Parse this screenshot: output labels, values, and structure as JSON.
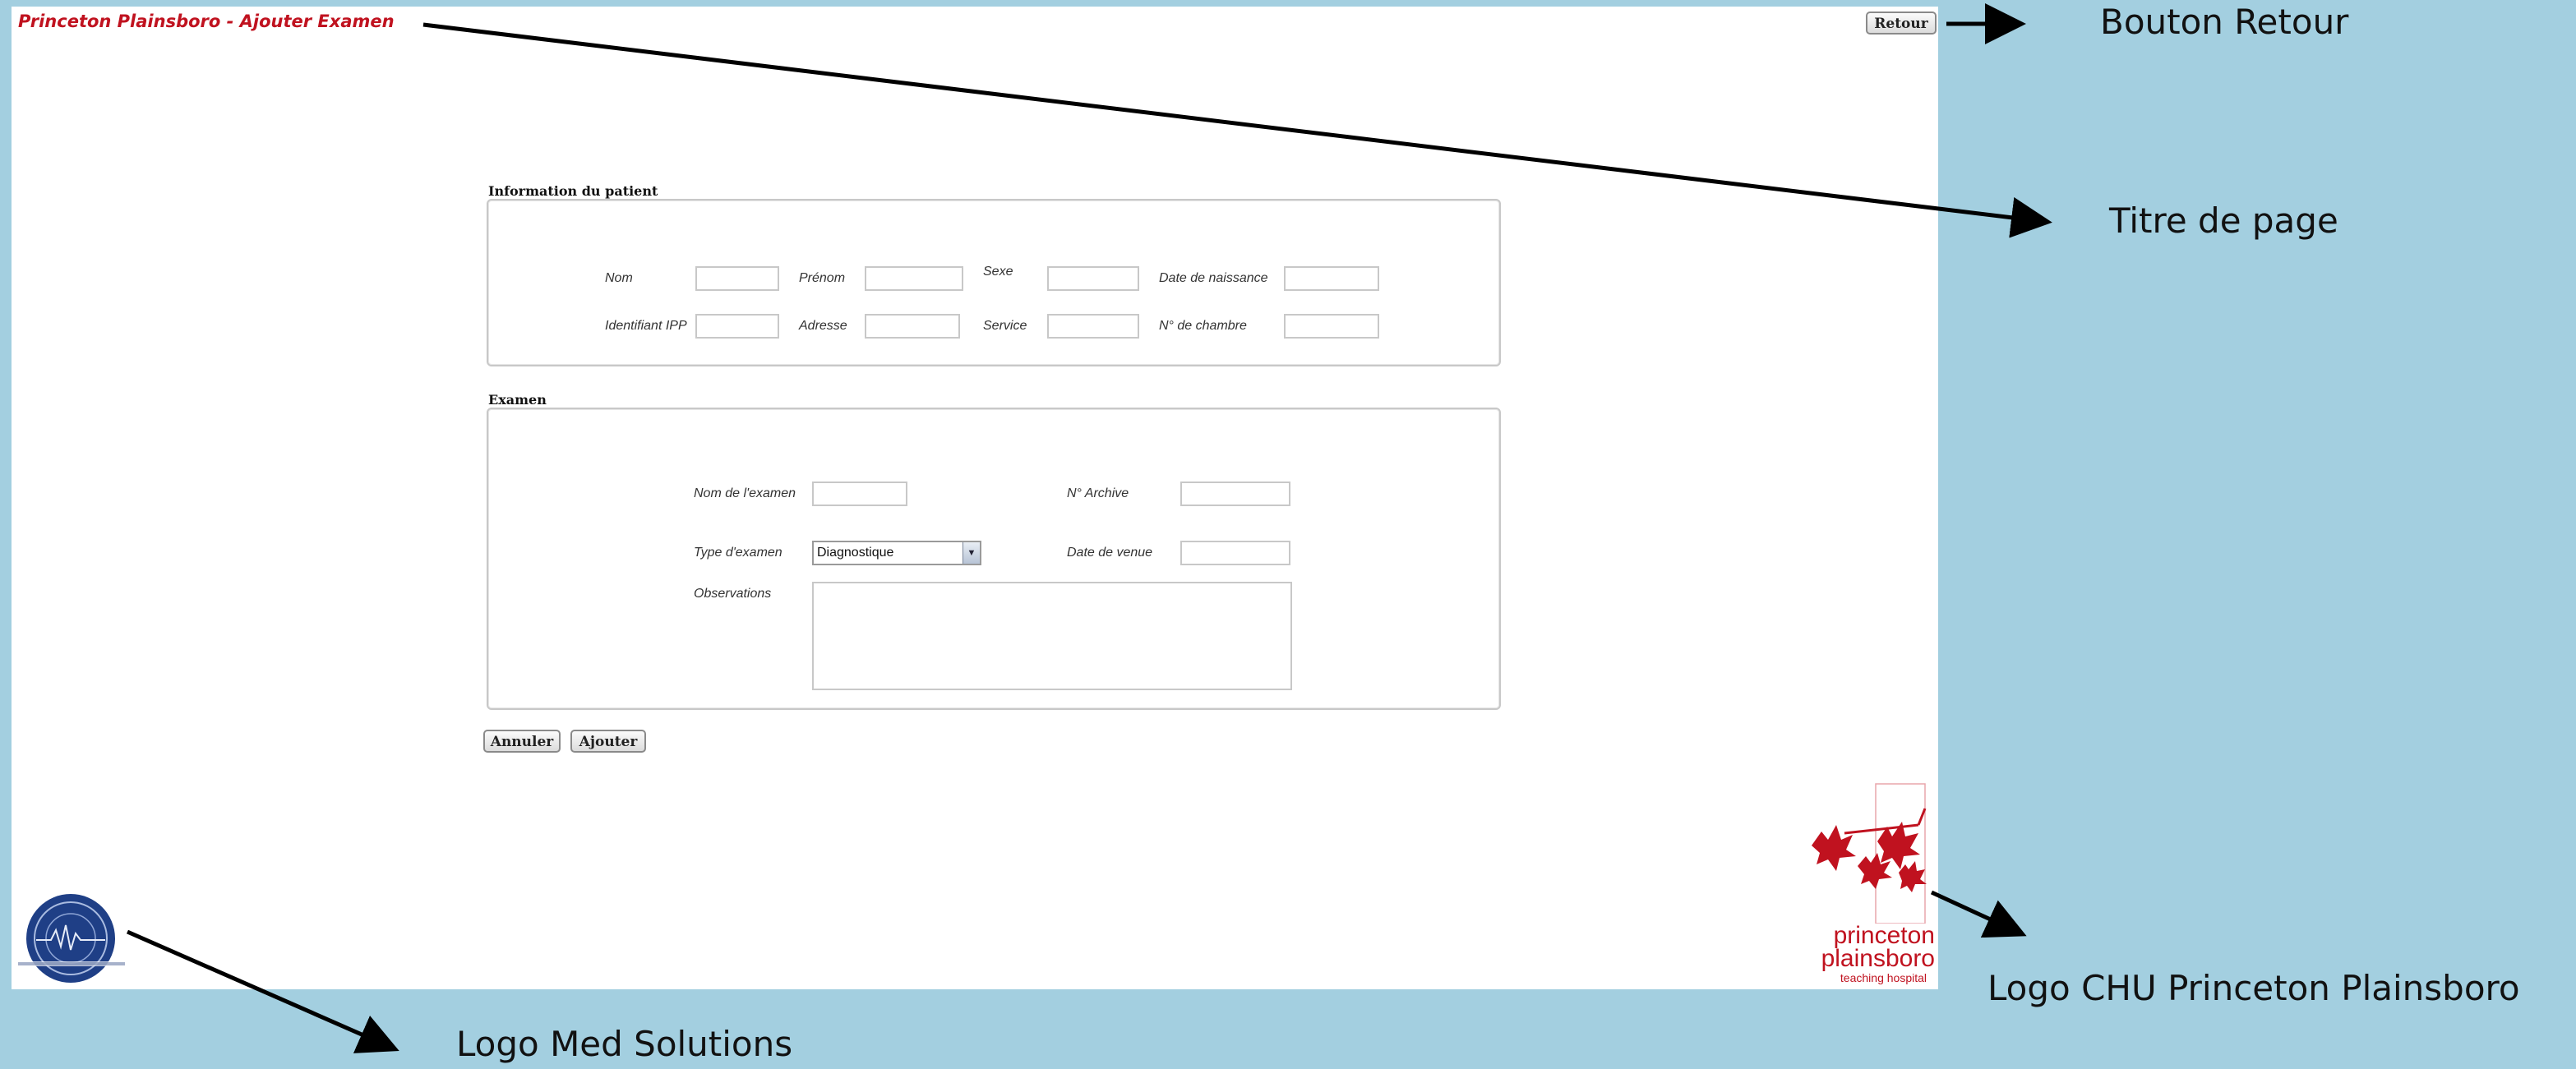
{
  "window": {
    "title": "Princeton Plainsboro - Ajouter Examen",
    "back_button": "Retour"
  },
  "patient_section": {
    "title": "Information du patient",
    "fields": {
      "nom": "Nom",
      "prenom": "Prénom",
      "sexe": "Sexe",
      "date_naissance": "Date de naissance",
      "ipp": "Identifiant IPP",
      "adresse": "Adresse",
      "service": "Service",
      "chambre": "N° de chambre"
    }
  },
  "exam_section": {
    "title": "Examen",
    "fields": {
      "nom_examen": "Nom de l'examen",
      "archive": "N° Archive",
      "type_examen": "Type d'examen",
      "date_venue": "Date de venue",
      "observations": "Observations"
    },
    "type_examen_value": "Diagnostique"
  },
  "actions": {
    "cancel": "Annuler",
    "add": "Ajouter"
  },
  "hospital_logo": {
    "line1": "princeton",
    "line2": "plainsboro",
    "line3": "teaching hospital",
    "color": "#c0121f"
  },
  "annotations": {
    "back_button": "Bouton Retour",
    "page_title": "Titre de page",
    "medsolutions_logo": "Logo Med Solutions",
    "hospital_logo": "Logo CHU Princeton Plainsboro"
  },
  "colors": {
    "background": "#a3cfe0",
    "title_red": "#c0121f",
    "seal_blue": "#1f3f86"
  }
}
